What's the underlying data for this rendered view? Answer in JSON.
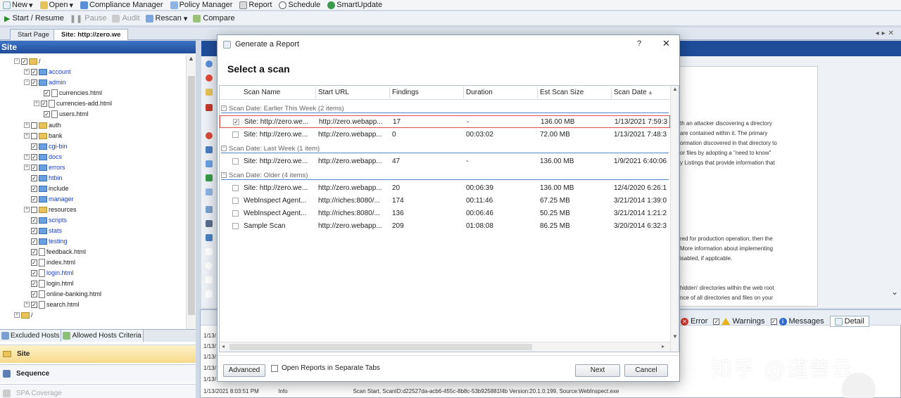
{
  "menubar": {
    "items": [
      "New",
      "Open",
      "Compliance Manager",
      "Policy Manager",
      "Report",
      "Schedule",
      "SmartUpdate"
    ]
  },
  "toolbar": {
    "start_resume": "Start / Resume",
    "pause": "Pause",
    "audit": "Audit",
    "rescan": "Rescan",
    "compare": "Compare"
  },
  "tabs": {
    "start_page": "Start Page",
    "site": "Site: http://zero.we"
  },
  "left_panel": {
    "title": "Site",
    "tree": [
      {
        "label": "/",
        "color": "normal"
      },
      {
        "label": "account",
        "color": "blue"
      },
      {
        "label": "admin",
        "color": "blue"
      },
      {
        "label": "currencies.html",
        "color": "normal"
      },
      {
        "label": "currencies-add.html",
        "color": "normal"
      },
      {
        "label": "users.html",
        "color": "normal"
      },
      {
        "label": "auth",
        "color": "normal"
      },
      {
        "label": "bank",
        "color": "normal"
      },
      {
        "label": "cgi-bin",
        "color": "blue"
      },
      {
        "label": "docs",
        "color": "blue"
      },
      {
        "label": "errors",
        "color": "blue"
      },
      {
        "label": "htbin",
        "color": "blue"
      },
      {
        "label": "include",
        "color": "normal"
      },
      {
        "label": "manager",
        "color": "blue"
      },
      {
        "label": "resources",
        "color": "normal"
      },
      {
        "label": "scripts",
        "color": "blue"
      },
      {
        "label": "stats",
        "color": "blue"
      },
      {
        "label": "testing",
        "color": "blue"
      },
      {
        "label": "feedback.html",
        "color": "normal"
      },
      {
        "label": "index.html",
        "color": "normal"
      },
      {
        "label": "login.html",
        "color": "blue"
      },
      {
        "label": "login.html",
        "color": "normal"
      },
      {
        "label": "online-banking.html",
        "color": "normal"
      },
      {
        "label": "search.html",
        "color": "normal"
      },
      {
        "label": "/",
        "color": "normal"
      }
    ],
    "lower_tabs": {
      "excluded": "Excluded Hosts",
      "allowed": "Allowed Hosts Criteria"
    },
    "nav": {
      "site": "Site",
      "sequence": "Sequence",
      "spa": "SPA Coverage"
    }
  },
  "right_doc": {
    "lines": [
      "th an attacker discovering a directory",
      "are contained within it. The primary",
      "ormation discovered in that directory to",
      "or files by adopting a \"need to know\"",
      "y Listings that provide information that",
      "red for production operation, then the",
      "More information about implementing",
      "isabled, if applicable.",
      "hidden' directories within the web root",
      "nce of all directories and files on your"
    ]
  },
  "bottom_panel": {
    "filters": {
      "error": "Error",
      "warnings": "Warnings",
      "messages": "Messages",
      "detail": "Detail"
    },
    "log_rows": [
      {
        "date": "1/13/",
        "level": "",
        "message": ""
      },
      {
        "date": "1/13/",
        "level": "",
        "message": ""
      },
      {
        "date": "1/13/",
        "level": "",
        "message": ""
      },
      {
        "date": "1/13/",
        "level": "",
        "message": ""
      },
      {
        "date": "1/13/",
        "level": "",
        "message": ""
      },
      {
        "date": "1/13/2021 8:03:51 PM",
        "level": "Info",
        "message": "Scan Start, ScanID:d22527da-acb6-455c-8b8c-53b925881f4b Version:20.1.0.199, Source:WebInspect.exe"
      }
    ]
  },
  "watermark": "知乎 @道普云",
  "dialog": {
    "title": "Generate a Report",
    "help": "?",
    "close": "✕",
    "heading": "Select a scan",
    "columns": [
      "Scan Name",
      "Start URL",
      "Findings",
      "Duration",
      "Est Scan Size",
      "Scan Date"
    ],
    "groups": [
      {
        "label": "Scan Date: Earlier This Week (2 items)",
        "rows": [
          {
            "checked": true,
            "name": "Site: http://zero.we...",
            "url": "http://zero.webapp...",
            "findings": "17",
            "duration": "-",
            "size": "136.00 MB",
            "date": "1/13/2021 7:59:3"
          },
          {
            "checked": false,
            "name": "Site: http://zero.we...",
            "url": "http://zero.webapp...",
            "findings": "0",
            "duration": "00:03:02",
            "size": "72.00 MB",
            "date": "1/13/2021 7:48:3"
          }
        ]
      },
      {
        "label": "Scan Date: Last Week (1 item)",
        "rows": [
          {
            "checked": false,
            "name": "Site: http://zero.we...",
            "url": "http://zero.webapp...",
            "findings": "47",
            "duration": "-",
            "size": "136.00 MB",
            "date": "1/9/2021 6:40:06"
          }
        ]
      },
      {
        "label": "Scan Date: Older (4 items)",
        "rows": [
          {
            "checked": false,
            "name": "Site: http://zero.we...",
            "url": "http://zero.webapp...",
            "findings": "20",
            "duration": "00:06:39",
            "size": "136.00 MB",
            "date": "12/4/2020 6:26:1"
          },
          {
            "checked": false,
            "name": "WebInspect Agent...",
            "url": "http://riches:8080/...",
            "findings": "174",
            "duration": "00:11:46",
            "size": "67.25 MB",
            "date": "3/21/2014 1:39:0"
          },
          {
            "checked": false,
            "name": "WebInspect Agent...",
            "url": "http://riches:8080/...",
            "findings": "136",
            "duration": "00:06:46",
            "size": "50.25 MB",
            "date": "3/21/2014 1:21:2"
          },
          {
            "checked": false,
            "name": "Sample Scan",
            "url": "http://zero.webapp...",
            "findings": "209",
            "duration": "01:08:08",
            "size": "86.25 MB",
            "date": "3/20/2014 6:32:3"
          }
        ]
      }
    ],
    "advanced": "Advanced",
    "open_separate": "Open Reports in Separate Tabs",
    "next": "Next",
    "cancel": "Cancel"
  }
}
